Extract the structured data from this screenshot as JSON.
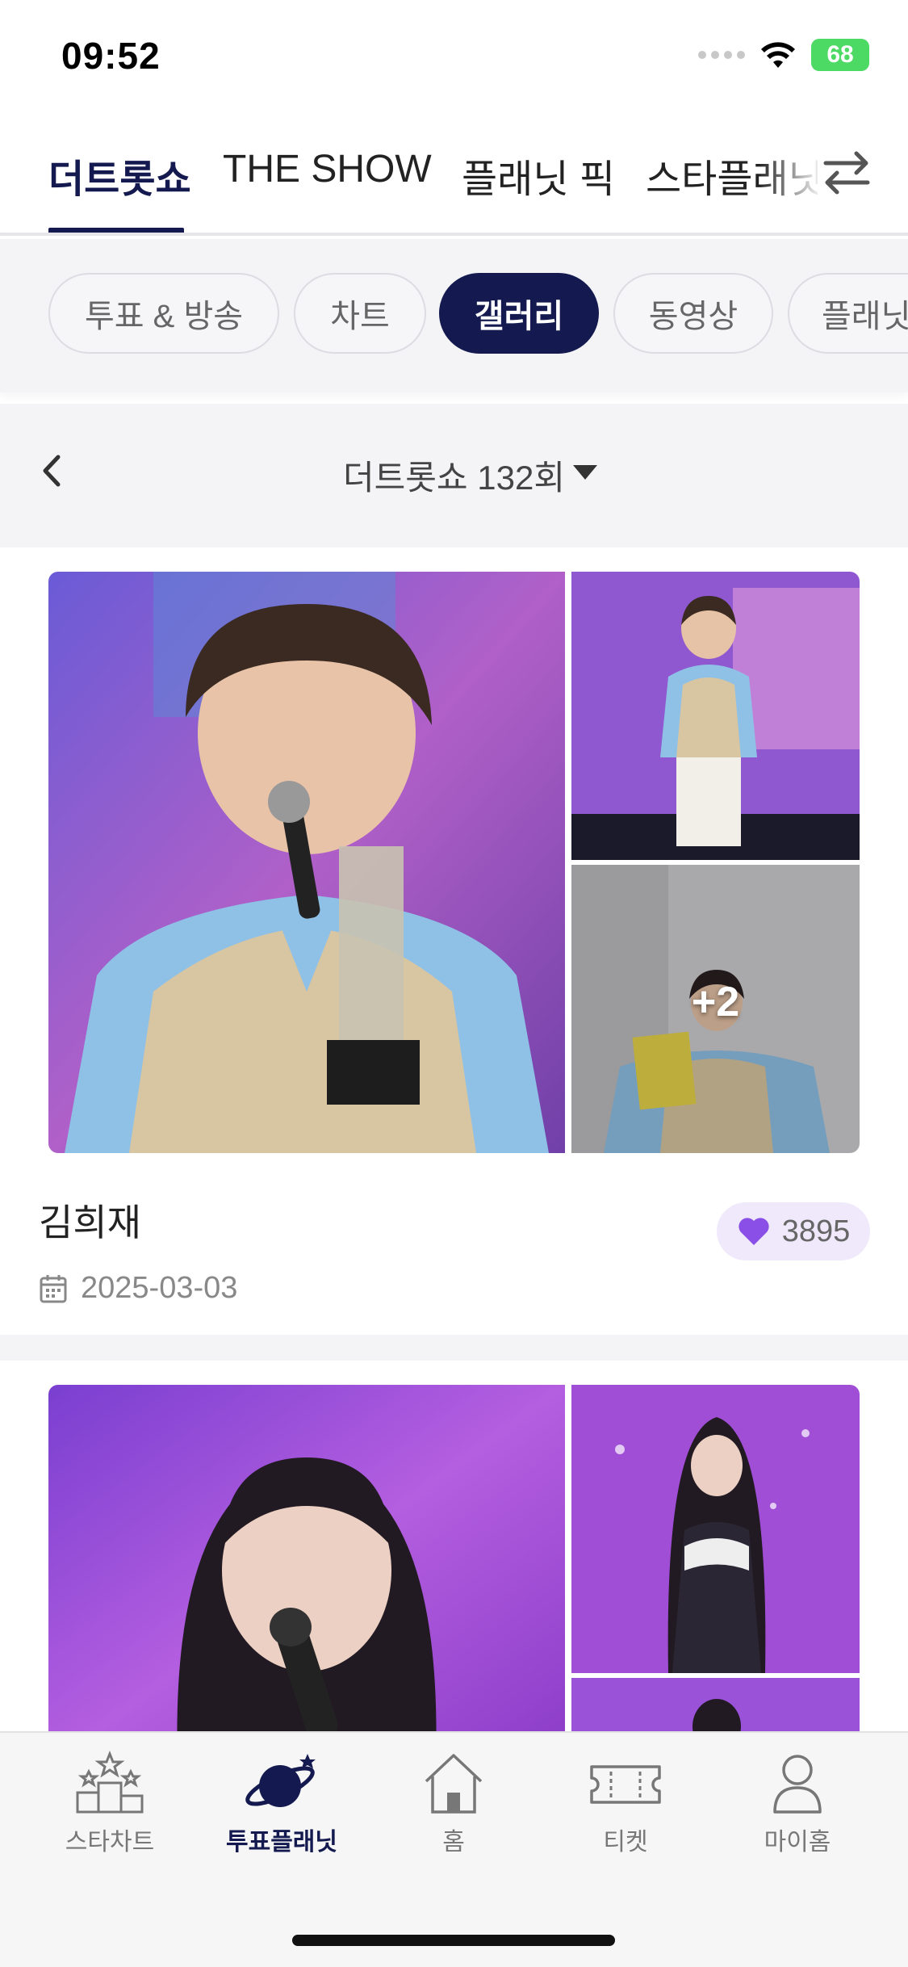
{
  "status_bar": {
    "time": "09:52",
    "battery": "68"
  },
  "top_tabs": [
    {
      "label": "더트롯쇼",
      "active": true
    },
    {
      "label": "THE SHOW",
      "active": false
    },
    {
      "label": "플래닛 픽",
      "active": false
    },
    {
      "label": "스타플래닛",
      "active": false
    }
  ],
  "filter_chips": [
    {
      "label": "투표 & 방송",
      "active": false
    },
    {
      "label": "차트",
      "active": false
    },
    {
      "label": "갤러리",
      "active": true
    },
    {
      "label": "동영상",
      "active": false
    },
    {
      "label": "플래닛",
      "active": false
    }
  ],
  "episode": {
    "label": "더트롯쇼 132회"
  },
  "gallery": [
    {
      "artist": "김희재",
      "likes": "3895",
      "date": "2025-03-03",
      "more_photos": "+2"
    },
    {
      "artist": "",
      "likes": "",
      "date": "",
      "more_photos": ""
    }
  ],
  "bottom_nav": [
    {
      "label": "스타차트",
      "icon": "star-podium-icon",
      "active": false
    },
    {
      "label": "투표플래닛",
      "icon": "planet-icon",
      "active": true
    },
    {
      "label": "홈",
      "icon": "home-icon",
      "active": false
    },
    {
      "label": "티켓",
      "icon": "ticket-icon",
      "active": false
    },
    {
      "label": "마이홈",
      "icon": "person-icon",
      "active": false
    }
  ],
  "colors": {
    "accent": "#141a4f",
    "like": "#8a4fe6",
    "like_bg": "#efe9fb"
  }
}
